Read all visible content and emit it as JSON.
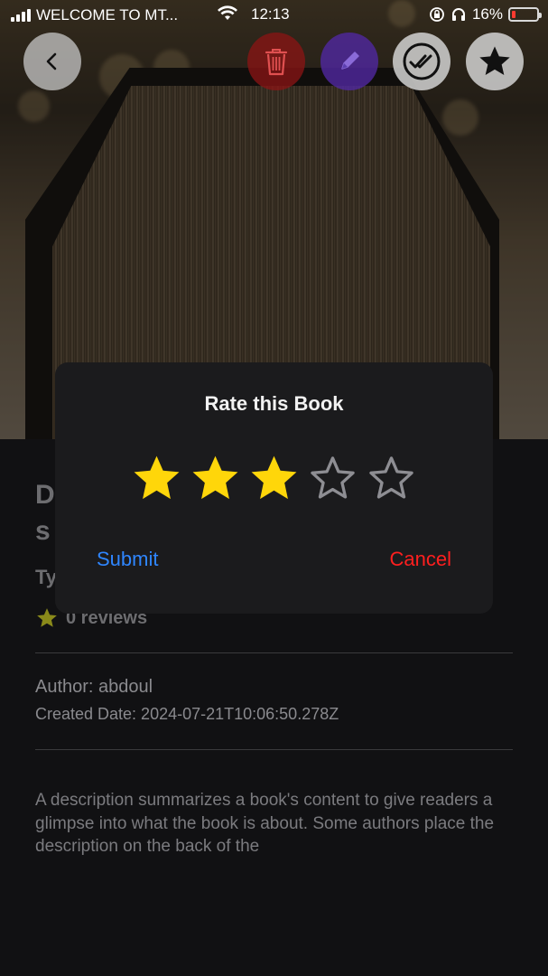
{
  "status_bar": {
    "carrier": "WELCOME TO MT...",
    "time": "12:13",
    "battery": "16%",
    "battery_level": 0.16,
    "battery_color": "#ff3b30"
  },
  "toolbar": {
    "back_icon": "chevron-left-icon",
    "delete_icon": "trash-icon",
    "edit_icon": "pencil-icon",
    "read_icon": "double-check-icon",
    "favorite_icon": "star-icon"
  },
  "book": {
    "title_peek": "D\ns",
    "type_peek": "Ty",
    "reviews": "0 reviews",
    "author": "Author: abdoul",
    "created": "Created Date: 2024-07-21T10:06:50.278Z",
    "description": "A description summarizes a book's content to give readers a glimpse into what the book is about. Some authors place the description on the back of the"
  },
  "rating_modal": {
    "title": "Rate this Book",
    "rating": 3,
    "max_rating": 5,
    "submit_label": "Submit",
    "cancel_label": "Cancel",
    "star_filled_color": "#ffd60a",
    "star_empty_color": "#8e8e93"
  },
  "colors": {
    "accent_blue": "#2f86ff",
    "danger_red": "#ff1f1f",
    "review_star": "#8a8a1a"
  }
}
